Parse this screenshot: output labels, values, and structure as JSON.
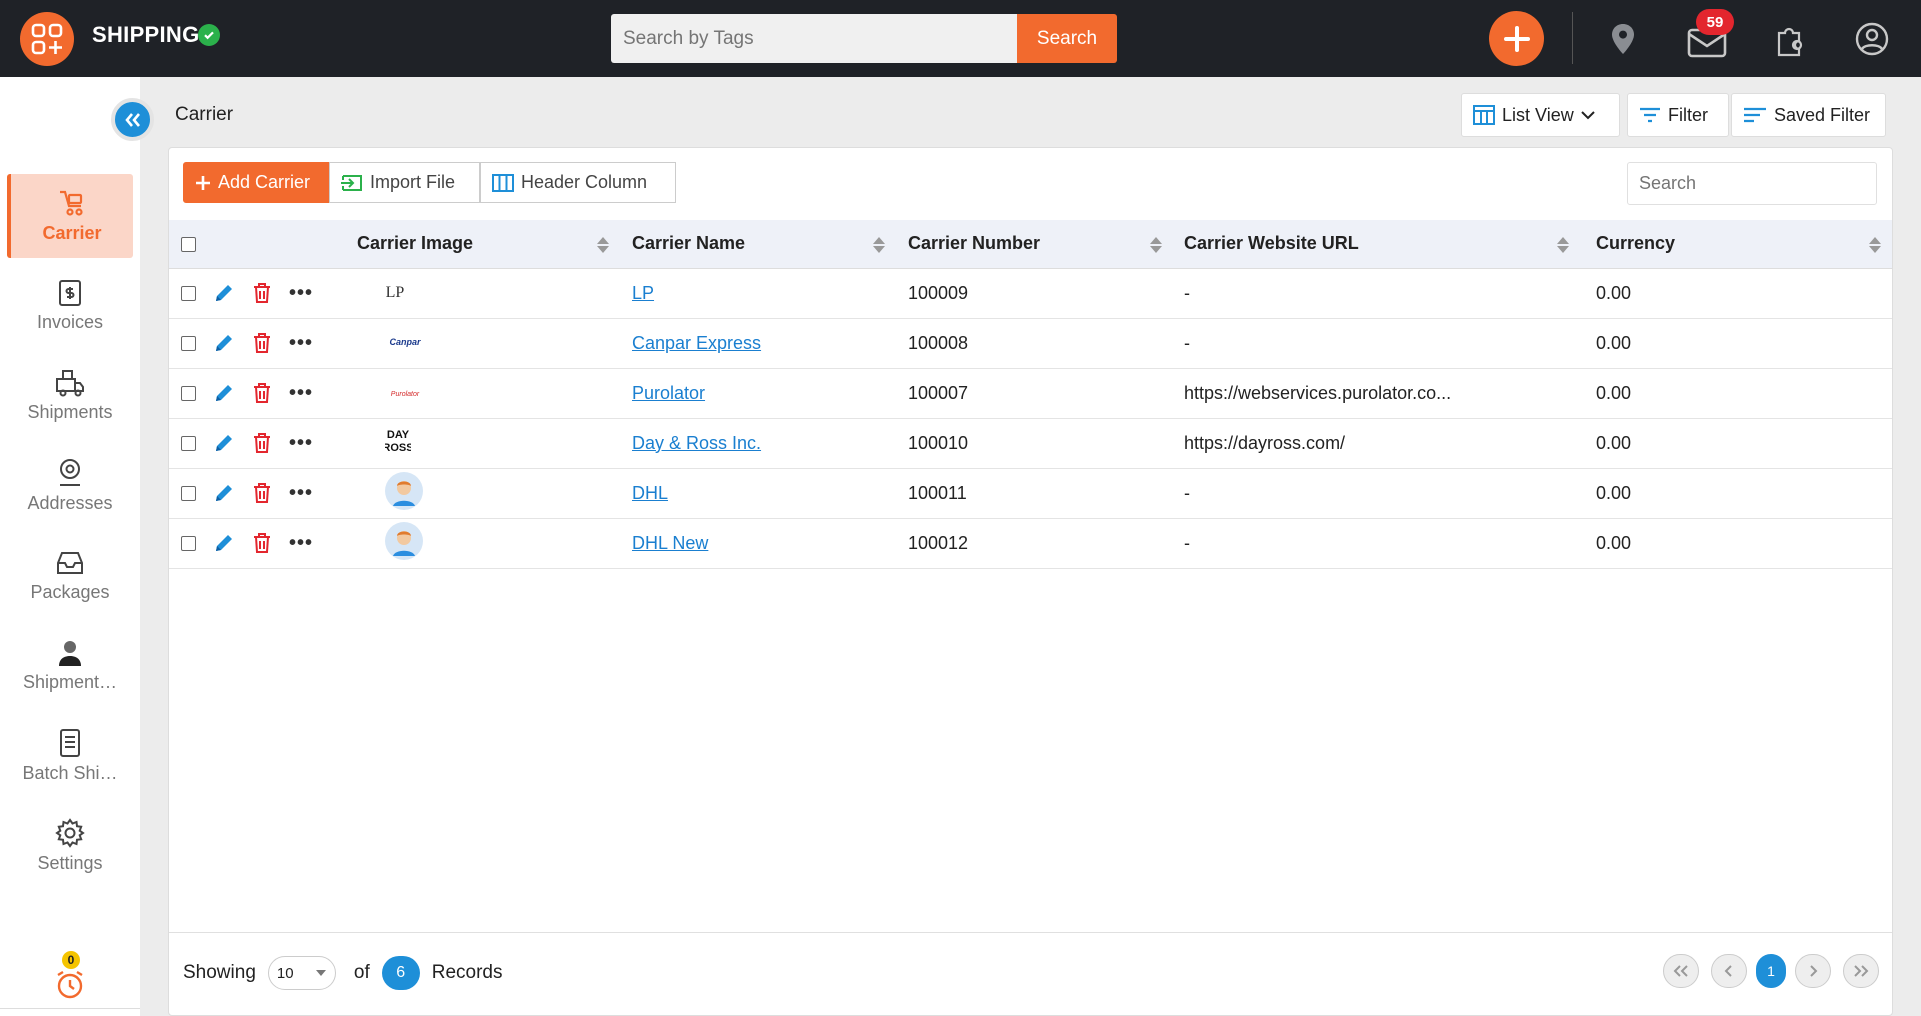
{
  "app": {
    "title": "SHIPPING",
    "notifications_count": "59",
    "alarm_count": "0"
  },
  "top_search": {
    "placeholder": "Search by Tags",
    "button_label": "Search"
  },
  "sidebar": {
    "items": [
      {
        "label": "Carrier",
        "icon": "cart-icon",
        "active": true
      },
      {
        "label": "Invoices",
        "icon": "invoice-icon"
      },
      {
        "label": "Shipments",
        "icon": "shipments-icon"
      },
      {
        "label": "Addresses",
        "icon": "address-pin-icon"
      },
      {
        "label": "Packages",
        "icon": "package-inbox-icon"
      },
      {
        "label": "Shipment…",
        "icon": "user-icon"
      },
      {
        "label": "Batch Shi…",
        "icon": "batch-document-icon"
      },
      {
        "label": "Settings",
        "icon": "gear-icon"
      }
    ]
  },
  "page": {
    "title": "Carrier",
    "view_label": "List View",
    "filter_label": "Filter",
    "saved_filter_label": "Saved Filter"
  },
  "toolbar": {
    "add_label": "Add Carrier",
    "import_label": "Import File",
    "header_column_label": "Header Column",
    "search_placeholder": "Search"
  },
  "table": {
    "columns": [
      "Carrier Image",
      "Carrier Name",
      "Carrier Number",
      "Carrier Website URL",
      "Currency"
    ],
    "rows": [
      {
        "image": "LP",
        "name": "LP",
        "number": "100009",
        "url": "-",
        "currency": "0.00"
      },
      {
        "image": "Canpar",
        "name": "Canpar Express",
        "number": "100008",
        "url": "-",
        "currency": "0.00"
      },
      {
        "image": "Purolator",
        "name": "Purolator",
        "number": "100007",
        "url": "https://webservices.purolator.co...",
        "currency": "0.00"
      },
      {
        "image": "DAY & ROSS",
        "name": "Day & Ross Inc.",
        "number": "100010",
        "url": "https://dayross.com/",
        "currency": "0.00"
      },
      {
        "image": "avatar",
        "name": "DHL",
        "number": "100011",
        "url": "-",
        "currency": "0.00"
      },
      {
        "image": "avatar",
        "name": "DHL New",
        "number": "100012",
        "url": "-",
        "currency": "0.00"
      }
    ]
  },
  "footer": {
    "showing_label": "Showing",
    "page_size": "10",
    "of_label": "of",
    "record_count": "6",
    "records_label": "Records",
    "current_page": "1"
  },
  "colors": {
    "accent": "#f26a2e",
    "primary_blue": "#1e8fd8",
    "topbar": "#1f2227",
    "success": "#2bb14b",
    "danger": "#e3262e"
  }
}
